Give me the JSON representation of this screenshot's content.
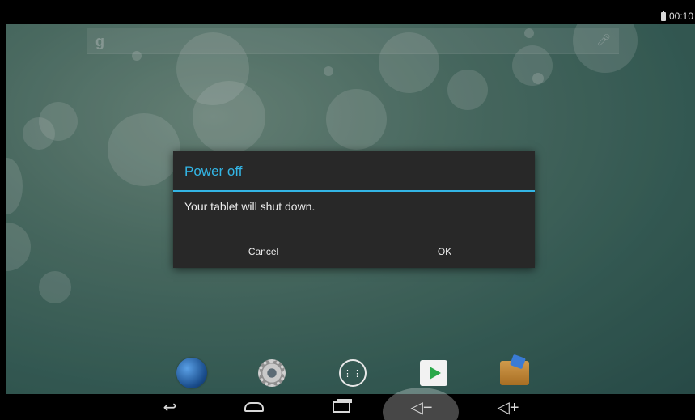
{
  "status_bar": {
    "time": "00:10"
  },
  "dialog": {
    "title": "Power off",
    "message": "Your tablet will shut down.",
    "cancel_label": "Cancel",
    "ok_label": "OK"
  },
  "search": {
    "logo": "g",
    "voice_icon": "mic-icon"
  },
  "dock": {
    "apps": [
      {
        "icon": "browser-globe-icon"
      },
      {
        "icon": "settings-gear-icon"
      },
      {
        "icon": "app-drawer-icon",
        "glyph": "⋮⋮"
      },
      {
        "icon": "play-store-icon"
      },
      {
        "icon": "file-manager-icon"
      }
    ]
  },
  "navbar": {
    "back": "back-icon",
    "home": "home-icon",
    "recents": "recents-icon",
    "volume_down": "◁−",
    "volume_up": "◁+"
  },
  "colors": {
    "accent": "#33b5e5",
    "dialog_bg": "#282828"
  }
}
